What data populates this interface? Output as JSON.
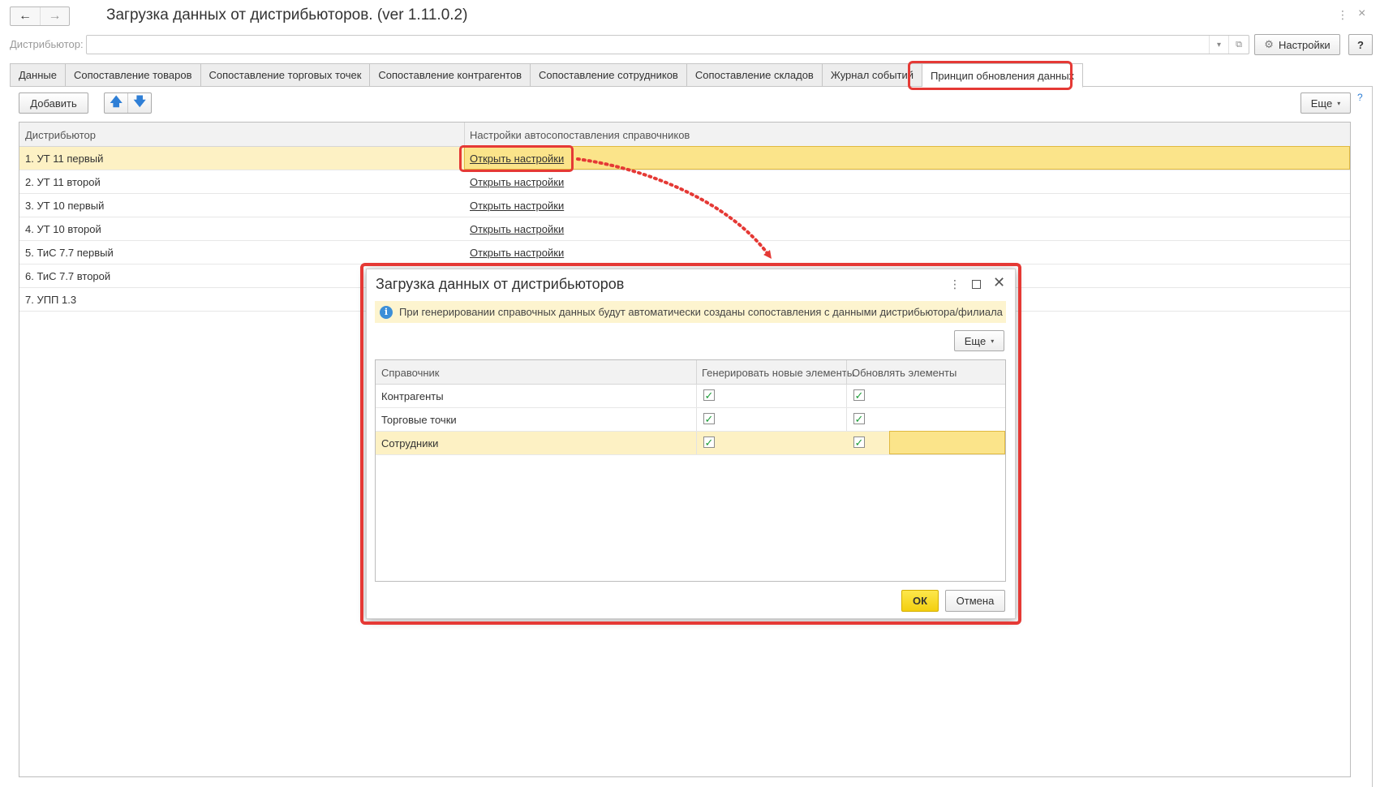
{
  "window": {
    "title": "Загрузка данных от дистрибьюторов. (ver 1.11.0.2)",
    "back_icon": "←",
    "forward_icon": "→",
    "more_icon": "⋮",
    "close_icon": "×"
  },
  "distributor_field": {
    "label": "Дистрибьютор:",
    "value": "",
    "dropdown_icon": "▾",
    "open_icon": "⧉"
  },
  "header_buttons": {
    "settings_label": "Настройки",
    "settings_icon": "⚙",
    "help_label": "?"
  },
  "tabs": [
    {
      "label": "Данные",
      "active": false
    },
    {
      "label": "Сопоставление товаров",
      "active": false
    },
    {
      "label": "Сопоставление торговых точек",
      "active": false
    },
    {
      "label": "Сопоставление контрагентов",
      "active": false
    },
    {
      "label": "Сопоставление сотрудников",
      "active": false
    },
    {
      "label": "Сопоставление складов",
      "active": false
    },
    {
      "label": "Журнал событий",
      "active": false
    },
    {
      "label": "Принцип обновления данных",
      "active": true
    }
  ],
  "toolbar": {
    "add_label": "Добавить",
    "up_icon": "🡅",
    "down_icon": "🡇",
    "more_label": "Еще",
    "caret": "▾",
    "help_label": "?"
  },
  "table": {
    "columns": [
      "Дистрибьютор",
      "Настройки автосопоставления справочников"
    ],
    "rows": [
      {
        "distributor": "1. УТ 11 первый",
        "settings": "Открыть настройки",
        "selected": true
      },
      {
        "distributor": "2. УТ 11 второй",
        "settings": "Открыть настройки",
        "selected": false
      },
      {
        "distributor": "3. УТ 10 первый",
        "settings": "Открыть настройки",
        "selected": false
      },
      {
        "distributor": "4. УТ 10 второй",
        "settings": "Открыть настройки",
        "selected": false
      },
      {
        "distributor": "5. ТиС 7.7 первый",
        "settings": "Открыть настройки",
        "selected": false
      },
      {
        "distributor": "6. ТиС 7.7 второй",
        "settings": "",
        "selected": false
      },
      {
        "distributor": "7. УПП 1.3",
        "settings": "",
        "selected": false
      }
    ]
  },
  "dialog": {
    "title": "Загрузка данных от дистрибьюторов",
    "more_icon": "⋮",
    "close_icon": "✕",
    "info_icon": "i",
    "info_text": "При генерировании справочных данных будут автоматически созданы сопоставления с данными дистрибьютора/филиала",
    "more_label": "Еще",
    "columns": [
      "Справочник",
      "Генерировать новые элементы",
      "Обновлять элементы"
    ],
    "rows": [
      {
        "name": "Контрагенты",
        "generate": true,
        "update": true,
        "selected": false
      },
      {
        "name": "Торговые точки",
        "generate": true,
        "update": true,
        "selected": false
      },
      {
        "name": "Сотрудники",
        "generate": true,
        "update": true,
        "selected": true
      }
    ],
    "check_mark": "✓",
    "ok_label": "ОК",
    "cancel_label": "Отмена"
  },
  "colors": {
    "highlight_red": "#e53935",
    "selection_yellow": "#fdf1c4",
    "ok_yellow": "#f3cf10",
    "info_blue": "#3c8fd8"
  }
}
